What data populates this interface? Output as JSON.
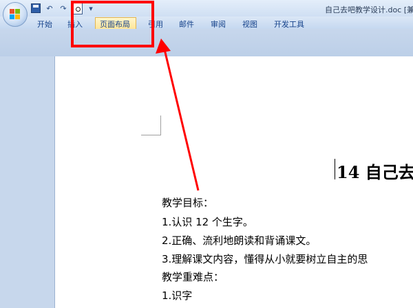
{
  "window": {
    "title": "自己去吧教学设计.doc [兼容"
  },
  "quick_access": {
    "icons": [
      "save-icon",
      "undo-icon",
      "redo-icon",
      "print-preview-icon",
      "customize-dropdown-icon"
    ],
    "dropdown_glyph": "▾"
  },
  "ribbon": {
    "tabs": [
      {
        "label": "开始"
      },
      {
        "label": "插入"
      },
      {
        "label": "页面布局",
        "active": true
      },
      {
        "label": "引用"
      },
      {
        "label": "邮件"
      },
      {
        "label": "审阅"
      },
      {
        "label": "视图"
      },
      {
        "label": "开发工具"
      }
    ]
  },
  "document": {
    "title": "14 自己去",
    "lines": [
      "教学目标：",
      "1.认识 12 个生字。",
      "2.正确、流利地朗读和背诵课文。",
      "3.理解课文内容，懂得从小就要树立自主的思",
      "教学重难点：",
      "1.识字"
    ]
  },
  "annotation": {
    "color": "#ff0000"
  }
}
